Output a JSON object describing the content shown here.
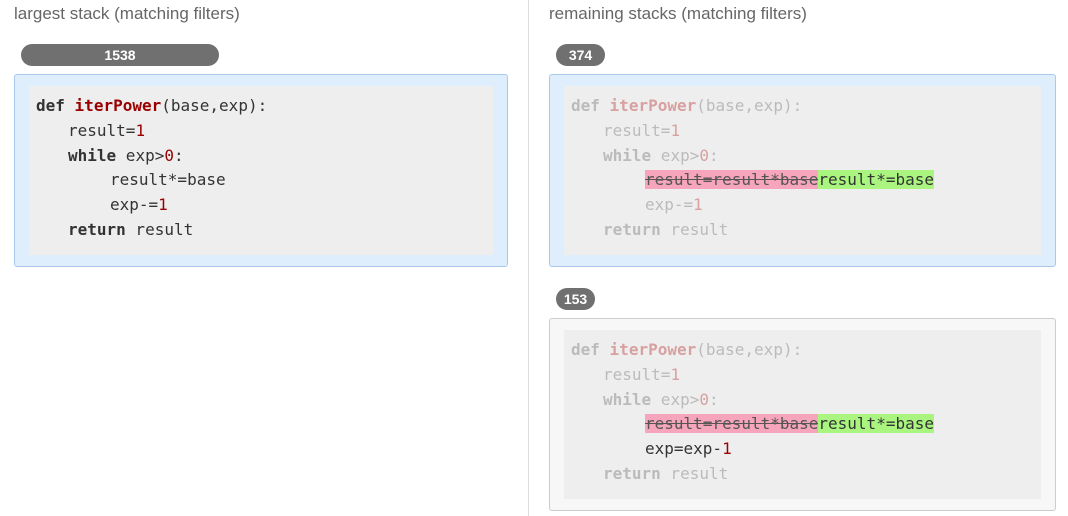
{
  "left": {
    "title": "largest stack (matching filters)",
    "count": "1538",
    "code": {
      "l1": {
        "kw": "def",
        "fn": "iterPower",
        "rest": "(base,exp):"
      },
      "l2": {
        "a": "result=",
        "num": "1"
      },
      "l3": {
        "kw": "while",
        "a": " exp>",
        "num": "0",
        "b": ":"
      },
      "l4": {
        "a": "result*=base"
      },
      "l5": {
        "a": "exp-=",
        "num": "1"
      },
      "l6": {
        "kw": "return",
        "a": " result"
      }
    }
  },
  "right": {
    "title": "remaining stacks (matching filters)",
    "stacks": [
      {
        "count": "374",
        "code": {
          "l1": {
            "kw": "def",
            "fn": "iterPower",
            "rest": "(base,exp):"
          },
          "l2": {
            "a": "result=",
            "num": "1"
          },
          "l3": {
            "kw": "while",
            "a": " exp>",
            "num": "0",
            "b": ":"
          },
          "l4": {
            "del": "result=result*base",
            "ins": "result*=base"
          },
          "l5": {
            "a": "exp-=",
            "num": "1"
          },
          "l6": {
            "kw": "return",
            "a": " result"
          }
        }
      },
      {
        "count": "153",
        "code": {
          "l1": {
            "kw": "def",
            "fn": "iterPower",
            "rest": "(base,exp):"
          },
          "l2": {
            "a": "result=",
            "num": "1"
          },
          "l3": {
            "kw": "while",
            "a": " exp>",
            "num": "0",
            "b": ":"
          },
          "l4": {
            "del": "result=result*base",
            "ins": "result*=base"
          },
          "l5": {
            "a": "exp=exp-",
            "num": "1"
          },
          "l6": {
            "kw": "return",
            "a": " result"
          }
        }
      }
    ]
  },
  "colors": {
    "panel_selected_bg": "#dfeefd",
    "panel_bg": "#f7f7f7",
    "badge_bg": "#707070",
    "deleted_highlight": "#f7a5bc",
    "inserted_highlight": "#a9f57f",
    "number_color": "#990000"
  }
}
